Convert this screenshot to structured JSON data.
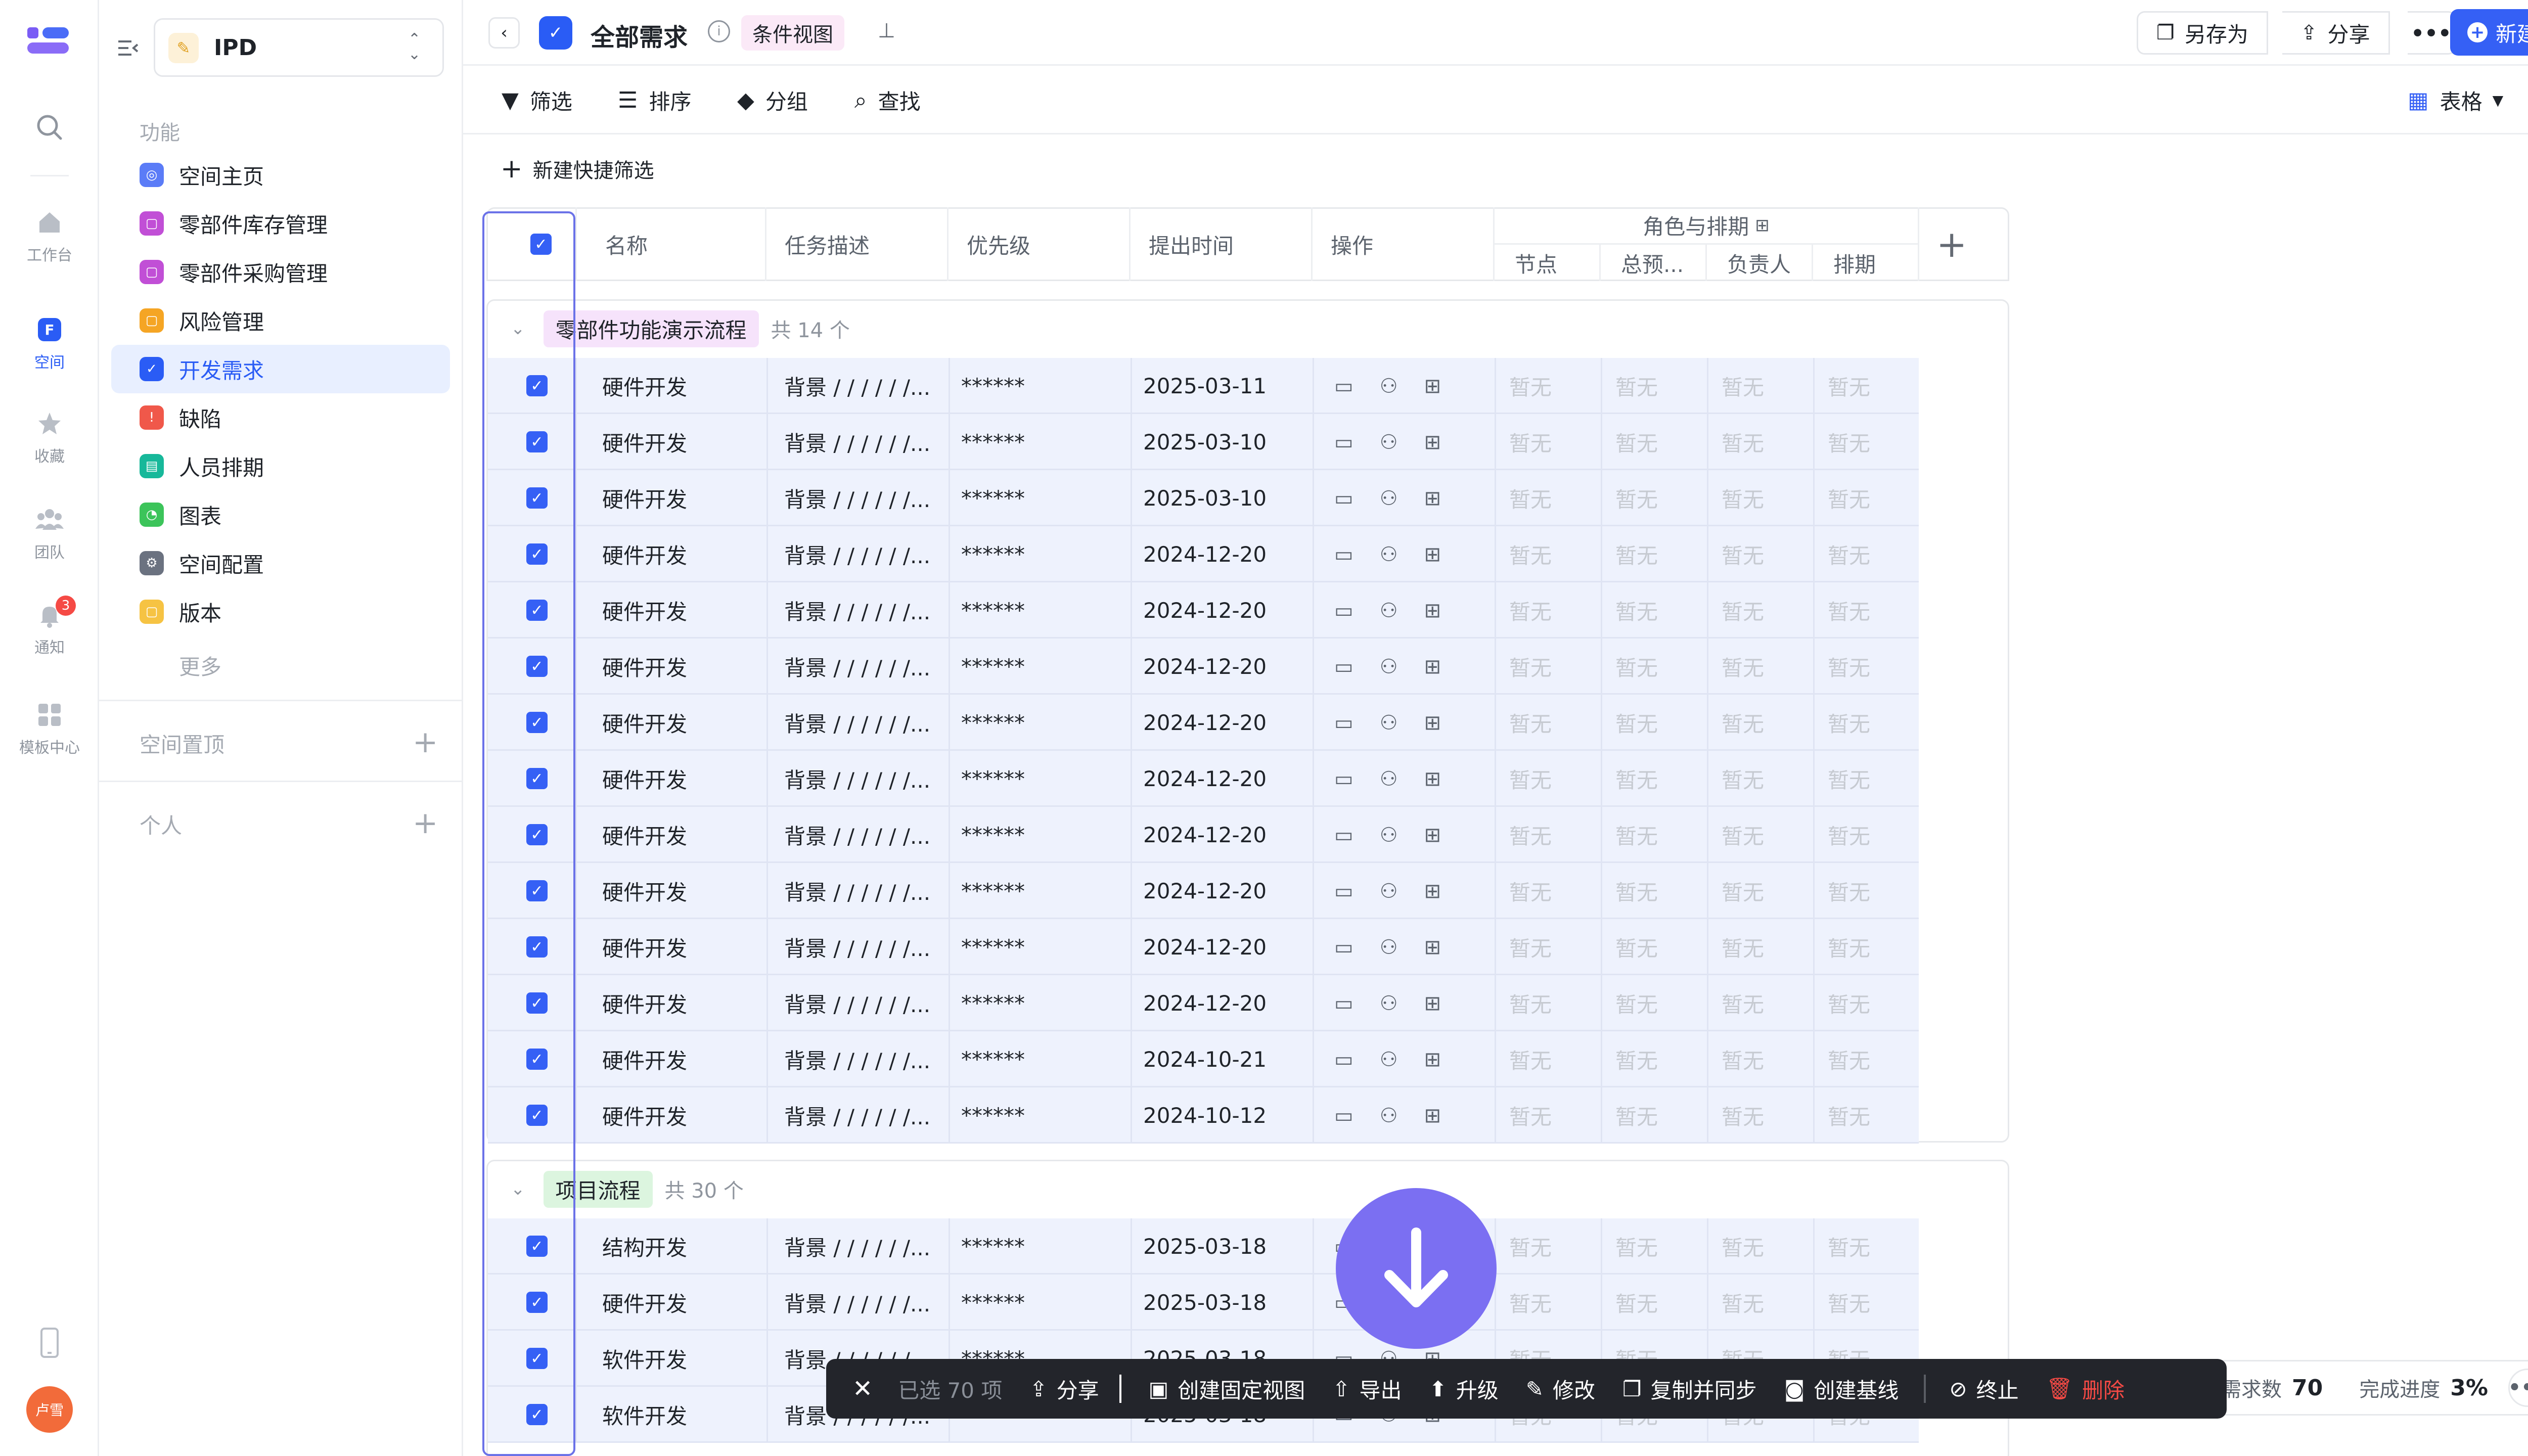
{
  "app": {
    "brand_color": "#3560f5",
    "logo": "stacked-bars-logo"
  },
  "rail": {
    "items": [
      {
        "label": "工作台"
      },
      {
        "label": "空间"
      },
      {
        "label": "收藏"
      },
      {
        "label": "团队"
      },
      {
        "label": "通知",
        "badge": "3"
      },
      {
        "label": "模板中心"
      }
    ],
    "avatar": "卢雪"
  },
  "sidebar": {
    "space_name": "IPD",
    "section_label": "功能",
    "items": [
      {
        "label": "空间主页",
        "color": "#5b7cf7"
      },
      {
        "label": "零部件库存管理",
        "color": "#c14fd6"
      },
      {
        "label": "零部件采购管理",
        "color": "#c14fd6"
      },
      {
        "label": "风险管理",
        "color": "#f5a524"
      },
      {
        "label": "开发需求",
        "color": "#2a5cf5"
      },
      {
        "label": "缺陷",
        "color": "#f0584a"
      },
      {
        "label": "人员排期",
        "color": "#17b89a"
      },
      {
        "label": "图表",
        "color": "#3cc45a"
      },
      {
        "label": "空间配置",
        "color": "#6b7280"
      },
      {
        "label": "版本",
        "color": "#f6c343"
      }
    ],
    "more": "更多",
    "pinned": "空间置顶",
    "personal": "个人"
  },
  "header": {
    "title": "全部需求",
    "view_tag": "条件视图",
    "save_as": "另存为",
    "share": "分享",
    "new": "新建"
  },
  "toolbar": {
    "filter": "筛选",
    "sort": "排序",
    "group": "分组",
    "find": "查找",
    "view": "表格"
  },
  "quick_filter": "新建快捷筛选",
  "table": {
    "columns": {
      "name": "名称",
      "desc": "任务描述",
      "priority": "优先级",
      "date": "提出时间",
      "ops": "操作",
      "roles": "角色与排期",
      "node": "节点",
      "total": "总预...",
      "owner": "负责人",
      "schedule": "排期"
    },
    "placeholder": "暂无",
    "groups": [
      {
        "name": "零部件功能演示流程",
        "count": "共 14 个",
        "tag_color": "#f6e3fb",
        "rows": [
          {
            "name": "硬件开发",
            "desc": "背景 / / /  / / /...",
            "priority": "******",
            "date": "2025-03-11"
          },
          {
            "name": "硬件开发",
            "desc": "背景 / / /  / / /...",
            "priority": "******",
            "date": "2025-03-10"
          },
          {
            "name": "硬件开发",
            "desc": "背景 / / /  / / /...",
            "priority": "******",
            "date": "2025-03-10"
          },
          {
            "name": "硬件开发",
            "desc": "背景 / / /  / / /...",
            "priority": "******",
            "date": "2024-12-20"
          },
          {
            "name": "硬件开发",
            "desc": "背景 / / /  / / /...",
            "priority": "******",
            "date": "2024-12-20"
          },
          {
            "name": "硬件开发",
            "desc": "背景 / / /  / / /...",
            "priority": "******",
            "date": "2024-12-20"
          },
          {
            "name": "硬件开发",
            "desc": "背景 / / /  / / /...",
            "priority": "******",
            "date": "2024-12-20"
          },
          {
            "name": "硬件开发",
            "desc": "背景 / / /  / / /...",
            "priority": "******",
            "date": "2024-12-20"
          },
          {
            "name": "硬件开发",
            "desc": "背景 / / /  / / /...",
            "priority": "******",
            "date": "2024-12-20"
          },
          {
            "name": "硬件开发",
            "desc": "背景 / / /  / / /...",
            "priority": "******",
            "date": "2024-12-20"
          },
          {
            "name": "硬件开发",
            "desc": "背景 / / /  / / /...",
            "priority": "******",
            "date": "2024-12-20"
          },
          {
            "name": "硬件开发",
            "desc": "背景 / / /  / / /...",
            "priority": "******",
            "date": "2024-12-20"
          },
          {
            "name": "硬件开发",
            "desc": "背景 / / /  / / /...",
            "priority": "******",
            "date": "2024-10-21"
          },
          {
            "name": "硬件开发",
            "desc": "背景 / / /  / / /...",
            "priority": "******",
            "date": "2024-10-12"
          }
        ]
      },
      {
        "name": "项目流程",
        "count": "共 30 个",
        "tag_color": "#dcf5df",
        "rows": [
          {
            "name": "结构开发",
            "desc": "背景 / / /  / / /...",
            "priority": "******",
            "date": "2025-03-18"
          },
          {
            "name": "硬件开发",
            "desc": "背景 / / /  / / /...",
            "priority": "******",
            "date": "2025-03-18"
          },
          {
            "name": "软件开发",
            "desc": "背景 / / /  / / /...",
            "priority": "******",
            "date": "2025-03-18"
          },
          {
            "name": "软件开发",
            "desc": "背景 / / /  / / /...",
            "priority": "******",
            "date": "2025-03-18"
          }
        ]
      }
    ]
  },
  "bulk_bar": {
    "selected": "已选 70 项",
    "share": "分享",
    "create_view": "创建固定视图",
    "export": "导出",
    "upgrade": "升级",
    "edit": "修改",
    "copy_sync": "复制并同步",
    "baseline": "创建基线",
    "stop": "终止",
    "delete": "删除"
  },
  "stats": {
    "count_label": "需求数",
    "count": "70",
    "progress_label": "完成进度",
    "progress": "3%"
  }
}
